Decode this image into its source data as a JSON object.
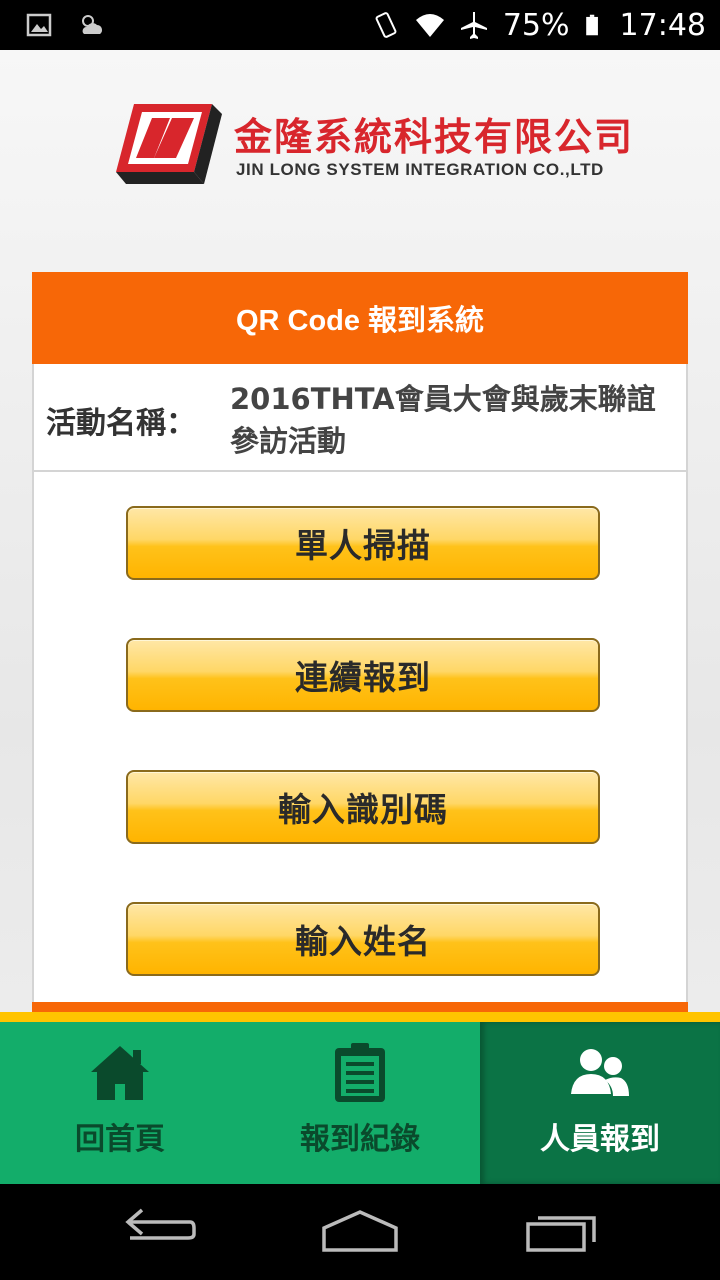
{
  "status_bar": {
    "battery": "75%",
    "time": "17:48",
    "icons": [
      "image-icon",
      "weather-icon",
      "vibrate-icon",
      "wifi-icon",
      "airplane-icon",
      "battery-icon"
    ]
  },
  "logo": {
    "name_zh": "金隆系統科技有限公司",
    "name_en": "JIN LONG SYSTEM INTEGRATION CO.,LTD"
  },
  "card": {
    "title": "QR Code 報到系統",
    "event_label": "活動名稱：",
    "event_name": "2016THTA會員大會與歲末聯誼參訪活動"
  },
  "actions": [
    {
      "label": "單人掃描"
    },
    {
      "label": "連續報到"
    },
    {
      "label": "輸入識別碼"
    },
    {
      "label": "輸入姓名"
    }
  ],
  "tabs": [
    {
      "label": "回首頁",
      "icon": "home-icon",
      "active": false
    },
    {
      "label": "報到紀錄",
      "icon": "clipboard-icon",
      "active": false
    },
    {
      "label": "人員報到",
      "icon": "people-icon",
      "active": true
    }
  ],
  "navbar": {
    "icons": [
      "back-icon",
      "home-nav-icon",
      "recents-icon"
    ]
  },
  "colors": {
    "header_orange": "#f76707",
    "tab_green": "#13ad6a",
    "tab_active_green": "#0b7345",
    "button_yellow": "#ffc21a",
    "logo_red": "#d8262c"
  }
}
